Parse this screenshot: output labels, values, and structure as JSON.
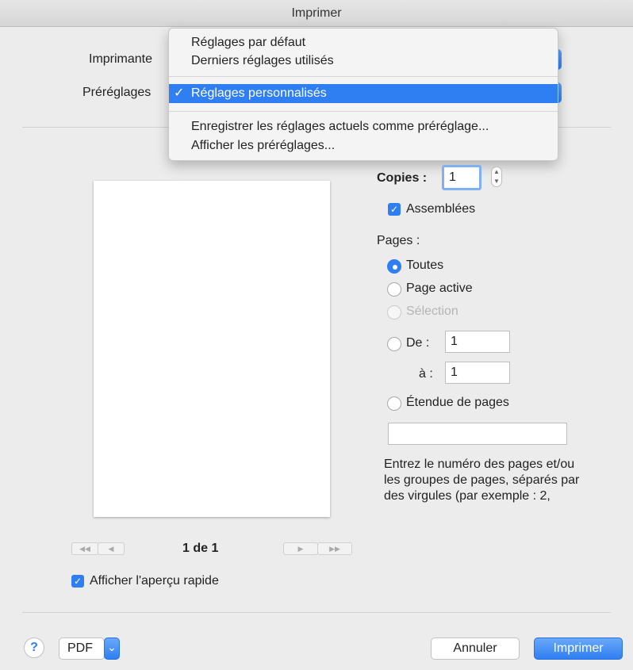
{
  "window": {
    "title": "Imprimer"
  },
  "labels": {
    "printer": "Imprimante",
    "presets": "Préréglages"
  },
  "presets_menu": {
    "items": [
      "Réglages par défaut",
      "Derniers réglages utilisés"
    ],
    "selected": "Réglages personnalisés",
    "check": "✓",
    "actions": [
      "Enregistrer les réglages actuels comme préréglage...",
      "Afficher les préréglages..."
    ]
  },
  "copies": {
    "label": "Copies :",
    "value": "1",
    "collate_label": "Assemblées",
    "collate_checked": true
  },
  "pages": {
    "label": "Pages :",
    "all": "Toutes",
    "current": "Page active",
    "selection": "Sélection",
    "from_label": "De :",
    "from_value": "1",
    "to_label": "à :",
    "to_value": "1",
    "range_label": "Étendue de pages",
    "range_value": "",
    "help_text": "Entrez le numéro des pages et/ou les groupes de pages, séparés par des virgules (par exemple : 2,",
    "selected": "all"
  },
  "preview": {
    "page_indicator": "1 de 1",
    "first_icon": "◀◀",
    "prev_icon": "◀",
    "next_icon": "▶",
    "last_icon": "▶▶",
    "quick_preview_label": "Afficher l'aperçu rapide",
    "quick_preview_checked": true
  },
  "footer": {
    "help": "?",
    "pdf": "PDF",
    "pdf_arrow": "⌄",
    "cancel": "Annuler",
    "print": "Imprimer"
  },
  "colors": {
    "accent": "#2f7ef2"
  }
}
